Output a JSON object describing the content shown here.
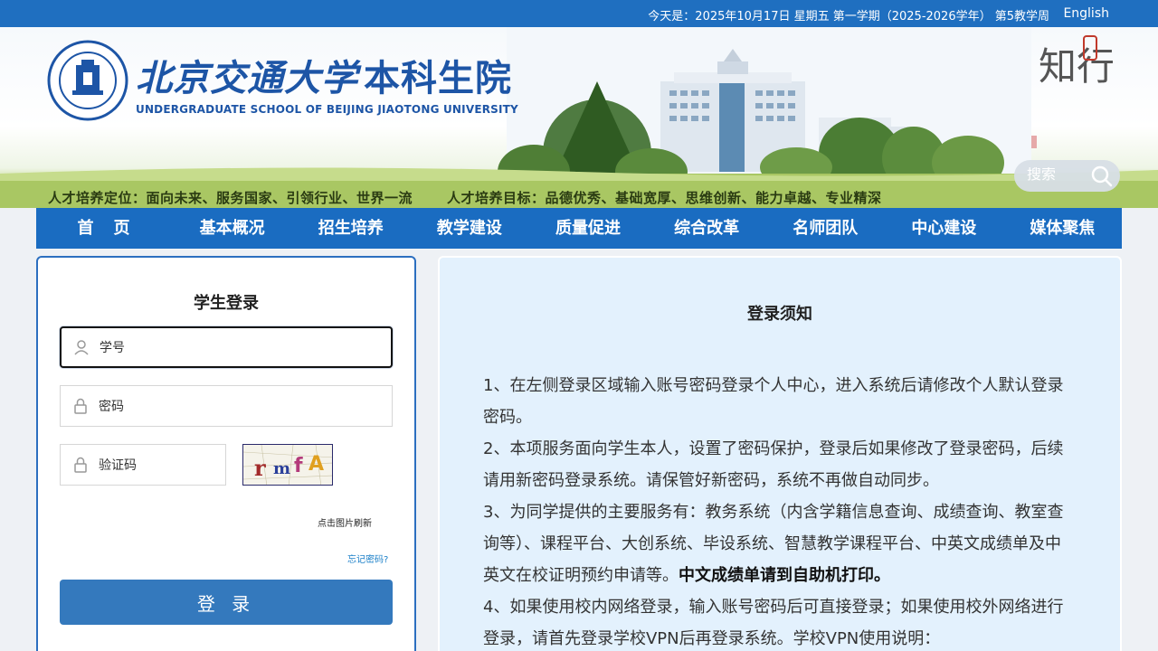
{
  "topbar": {
    "date_text": "今天是：2025年10月17日 星期五 第一学期（2025-2026学年） 第5教学周",
    "english_link": "English"
  },
  "header": {
    "logo_cn_script": "北京交通大学",
    "logo_cn_school": "本科生院",
    "logo_en": "UNDERGRADUATE SCHOOL OF BEIJING JIAOTONG UNIVERSITY",
    "motto": "知行",
    "slogan_1": "人才培养定位：面向未来、服务国家、引领行业、世界一流",
    "slogan_2": "人才培养目标：品德优秀、基础宽厚、思维创新、能力卓越、专业精深",
    "search_placeholder": "搜索"
  },
  "nav": {
    "items": [
      "首页",
      "基本概况",
      "招生培养",
      "教学建设",
      "质量促进",
      "综合改革",
      "名师团队",
      "中心建设",
      "媒体聚焦"
    ]
  },
  "login": {
    "title": "学生登录",
    "student_id_placeholder": "学号",
    "password_placeholder": "密码",
    "captcha_placeholder": "验证码",
    "captcha_text": "rmfA",
    "refresh_text": "点击图片刷新",
    "forgot_text": "忘记密码?",
    "submit_label": "登 录"
  },
  "notice": {
    "title": "登录须知",
    "p1": "1、在左侧登录区域输入账号密码登录个人中心，进入系统后请修改个人默认登录密码。",
    "p2": "2、本项服务面向学生本人，设置了密码保护，登录后如果修改了登录密码，后续请用新密码登录系统。请保管好新密码，系统不再做自动同步。",
    "p3": "3、为同学提供的主要服务有：教务系统（内含学籍信息查询、成绩查询、教室查询等）、课程平台、大创系统、毕设系统、智慧教学课程平台、中英文成绩单及中英文在校证明预约申请等。",
    "p3_bold": "中文成绩单请到自助机打印。",
    "p4": "4、如果使用校内网络登录，输入账号密码后可直接登录；如果使用校外网络进行登录，请首先登录学校VPN后再登录系统。学校VPN使用说明："
  },
  "colors": {
    "topbar_bg": "#1f6fc0",
    "nav_bg": "#1a6cc1",
    "login_button": "#3479bd",
    "notice_bg": "#e3f1fd",
    "brand_blue": "#1d55a6"
  },
  "icons": [
    "user-icon",
    "lock-icon",
    "search-icon"
  ]
}
